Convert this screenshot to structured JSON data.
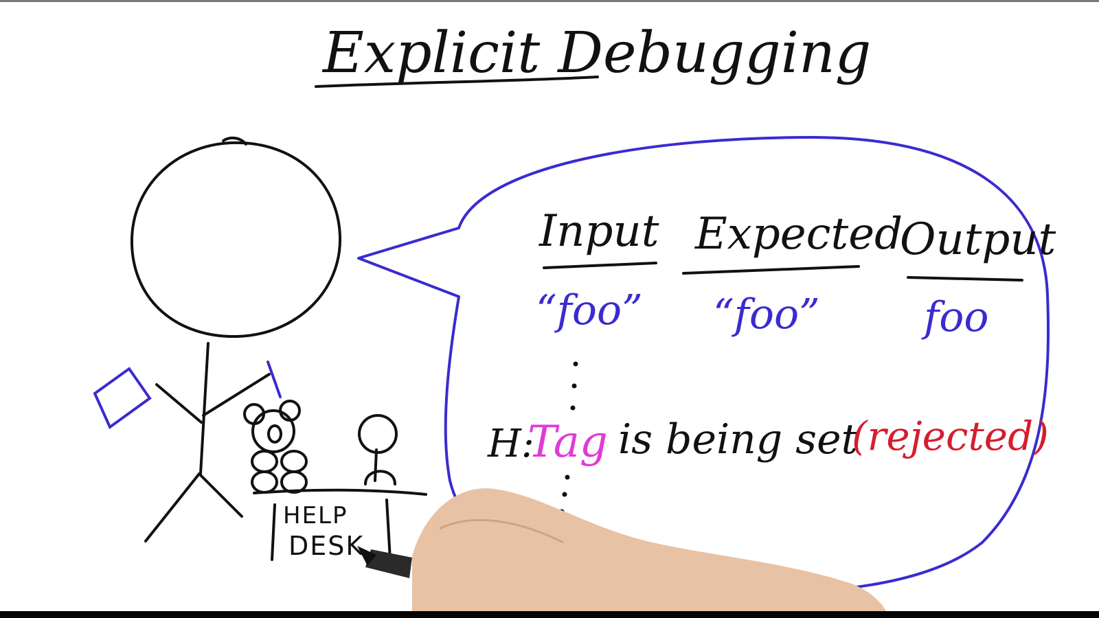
{
  "title": "Explicit Debugging",
  "table": {
    "headers": [
      "Input",
      "Expected",
      "Output"
    ],
    "row": [
      "“foo”",
      "“foo”",
      "foo"
    ]
  },
  "hypothesis": {
    "prefix": "H:",
    "subject": "Tag",
    "verb": "is being set",
    "status": "(rejected)"
  },
  "desk_label": [
    "HELP",
    "DESK"
  ],
  "colors": {
    "ink": "#111111",
    "bubble": "#3a2bd0",
    "values": "#3a2bd0",
    "subject": "#e13ad8",
    "status": "#d41e2e",
    "skin": "#e8c2a4"
  }
}
